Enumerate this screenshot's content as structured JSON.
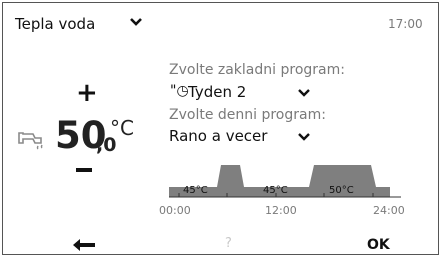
{
  "header": {
    "mode_label": "Tepla voda",
    "clock": "17:00"
  },
  "program": {
    "base_label": "Zvolte zakladni program:",
    "base_value": "Tyden 2",
    "base_icon": "week-clock-icon",
    "day_label": "Zvolte denni program:",
    "day_value": "Rano a vecer"
  },
  "temperature": {
    "integer": "50",
    "decimal": ",0",
    "unit": "°C",
    "increase_symbol": "+"
  },
  "schedule": {
    "segments": [
      {
        "label": "45°C"
      },
      {
        "label": "45°C"
      },
      {
        "label": "50°C"
      }
    ],
    "ticks": [
      "00:00",
      "12:00",
      "24:00"
    ],
    "fill_color": "#7f7f7f"
  },
  "footer": {
    "help_label": "?",
    "ok_label": "OK"
  }
}
